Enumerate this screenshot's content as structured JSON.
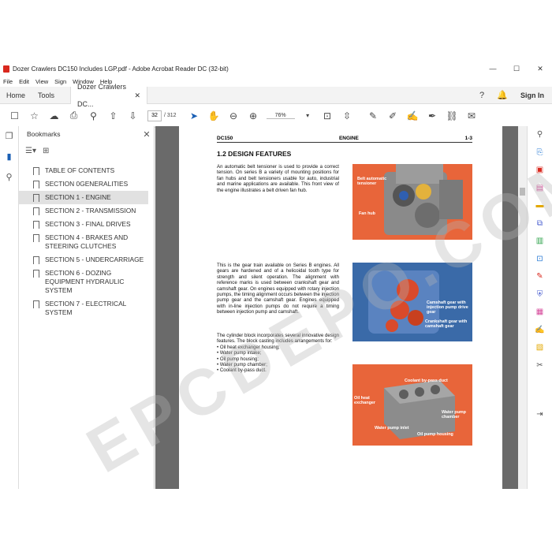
{
  "window": {
    "title": "Dozer Crawlers DC150 Includes LGP.pdf - Adobe Acrobat Reader DC (32-bit)",
    "controls": [
      "—",
      "☐",
      "✕"
    ]
  },
  "menu": [
    "File",
    "Edit",
    "View",
    "Sign",
    "Window",
    "Help"
  ],
  "tabs": {
    "home": "Home",
    "tools": "Tools",
    "doc": "Dozer Crawlers DC...",
    "doc_close": "✕",
    "signin": "Sign In"
  },
  "toolbar": {
    "page_current": "32",
    "page_count": "/ 312",
    "zoom": "76%"
  },
  "bookmarks": {
    "title": "Bookmarks",
    "items": [
      {
        "label": "TABLE OF CONTENTS"
      },
      {
        "label": "SECTION 0GENERALITIES"
      },
      {
        "label": "SECTION 1 - ENGINE",
        "selected": true
      },
      {
        "label": "SECTION 2 - TRANSMISSION"
      },
      {
        "label": "SECTION 3 - FINAL DRIVES"
      },
      {
        "label": "SECTION 4 - BRAKES AND STEERING CLUTCHES"
      },
      {
        "label": "SECTION 5 - UNDERCARRIAGE"
      },
      {
        "label": "SECTION 6 - DOZING EQUIPMENT HYDRAULIC SYSTEM"
      },
      {
        "label": "SECTION 7 - ELECTRICAL SYSTEM"
      }
    ]
  },
  "document": {
    "header_left": "DC150",
    "header_center": "ENGINE",
    "header_right": "1-3",
    "heading": "1.2 DESIGN FEATURES",
    "para1": "An automatic belt tensioner is used to provide a correct tension. On series B a variety of mounting positions for fan hubs and belt tensioners usable for auto, industrial and marine applications are available. This front view of the engine illustrates a belt driven fan hub.",
    "para2": "This is the gear train available on Series B engines. All gears are hardened and of a helicoidal tooth type for strength and silent operation. The alignment with reference marks is used between crankshaft gear and camshaft gear. On engines equipped with rotary injection pumps, the timing alignment occurs between the injection pump gear and the camshaft gear. Engines equipped with in-line injection pumps do not require a timing between injection pump and camshaft.",
    "para3": "The cylinder block incorporates several innovative design features. The block casting includes arrangements for:",
    "para3_list": [
      "• Oil heat exchanger housing;",
      "• Water pump intake;",
      "• Oil pump housing;",
      "• Water pump chamber;",
      "• Coolant by-pass duct."
    ],
    "fig1_labels": {
      "a": "Belt automatic tensioner",
      "b": "Fan hub"
    },
    "fig2_labels": {
      "a": "Camshaft gear with injection pump drive gear",
      "b": "Crankshaft gear with camshaft gear"
    },
    "fig3_labels": {
      "a": "Coolant by-pass duct",
      "b": "Oil heat exchanger",
      "c": "Water pump chamber",
      "d": "Water pump inlet",
      "e": "Oil pump housing"
    },
    "watermark": "EPCDEPO.COM"
  },
  "colors": {
    "accent": "#e8653a",
    "blue": "#3a6aa8",
    "viewer_bg": "#6a6a6a"
  }
}
